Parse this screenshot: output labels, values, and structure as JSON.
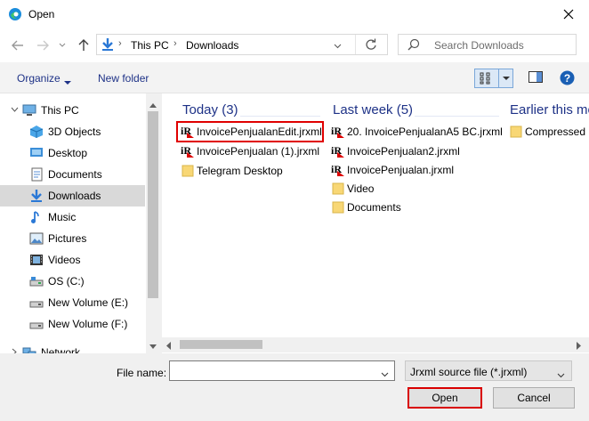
{
  "window": {
    "title": "Open"
  },
  "address": {
    "crumbs": [
      "This PC",
      "Downloads"
    ]
  },
  "search": {
    "placeholder": "Search Downloads"
  },
  "toolbar": {
    "organize": "Organize",
    "new_folder": "New folder"
  },
  "nav": {
    "items": [
      {
        "label": "This PC",
        "icon": "monitor-icon"
      },
      {
        "label": "3D Objects",
        "icon": "cube-icon"
      },
      {
        "label": "Desktop",
        "icon": "desktop-icon"
      },
      {
        "label": "Documents",
        "icon": "document-icon"
      },
      {
        "label": "Downloads",
        "icon": "download-icon",
        "selected": true
      },
      {
        "label": "Music",
        "icon": "music-icon"
      },
      {
        "label": "Pictures",
        "icon": "pictures-icon"
      },
      {
        "label": "Videos",
        "icon": "video-icon"
      },
      {
        "label": "OS (C:)",
        "icon": "drive-icon"
      },
      {
        "label": "New Volume (E:)",
        "icon": "drive-icon"
      },
      {
        "label": "New Volume (F:)",
        "icon": "drive-icon"
      },
      {
        "label": "Network",
        "icon": "network-icon"
      }
    ]
  },
  "groups": [
    {
      "header": "Today (3)",
      "files": [
        {
          "name": "InvoicePenjualanEdit.jrxml",
          "icon": "jrxml-file-icon",
          "highlighted": true
        },
        {
          "name": "InvoicePenjualan (1).jrxml",
          "icon": "jrxml-file-icon"
        },
        {
          "name": "Telegram Desktop",
          "icon": "folder-icon"
        }
      ]
    },
    {
      "header": "Last week (5)",
      "files": [
        {
          "name": "20. InvoicePenjualanA5 BC.jrxml",
          "icon": "jrxml-file-icon"
        },
        {
          "name": "InvoicePenjualan2.jrxml",
          "icon": "jrxml-file-icon"
        },
        {
          "name": "InvoicePenjualan.jrxml",
          "icon": "jrxml-file-icon"
        },
        {
          "name": "Video",
          "icon": "folder-icon"
        },
        {
          "name": "Documents",
          "icon": "folder-icon"
        }
      ]
    },
    {
      "header": "Earlier this mo",
      "files": [
        {
          "name": "Compressed",
          "icon": "folder-icon"
        }
      ]
    }
  ],
  "bottom": {
    "file_name_label": "File name:",
    "file_name_value": "",
    "file_type": "Jrxml source file (*.jrxml)",
    "open": "Open",
    "cancel": "Cancel"
  },
  "colors": {
    "accent": "#1e3287",
    "highlight": "#e00000",
    "folder": "#f8d775"
  }
}
